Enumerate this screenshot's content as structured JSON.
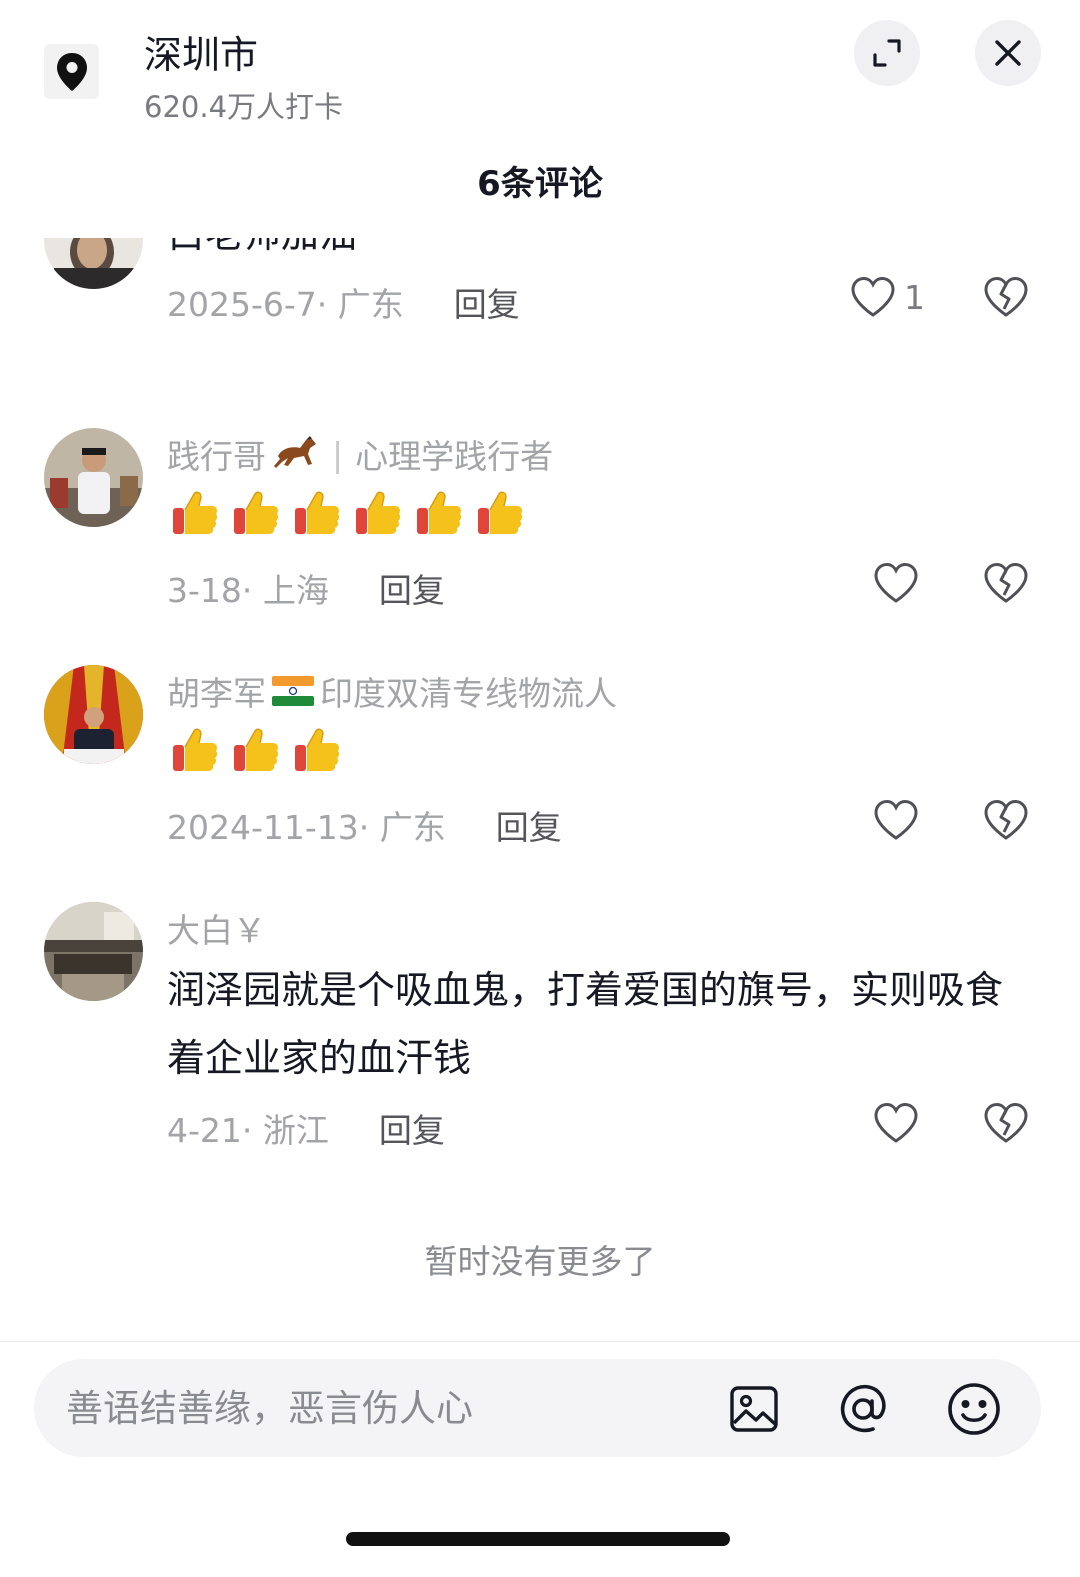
{
  "location": {
    "title": "深圳市",
    "checkins": "620.4万人打卡",
    "icon": "location-pin-icon"
  },
  "header": {
    "expand_icon": "expand-icon",
    "close_icon": "close-icon"
  },
  "comments_header": "6条评论",
  "comments": [
    {
      "author": "",
      "text": "白老师加油",
      "date_region": "2025-6-7· 广东",
      "reply_label": "回复",
      "like_count": "1"
    },
    {
      "author": "践行哥",
      "author_badge": "horse-emoji",
      "author_sep": "|",
      "author_title": "心理学践行者",
      "emoji": "thumbs-up",
      "emoji_count": 6,
      "date_region": "3-18· 上海",
      "reply_label": "回复"
    },
    {
      "author": "胡李军",
      "author_badge": "india-flag",
      "author_title": "印度双清专线物流人",
      "emoji": "thumbs-up",
      "emoji_count": 3,
      "date_region": "2024-11-13· 广东",
      "reply_label": "回复"
    },
    {
      "author": "大白￥",
      "text": "润泽园就是个吸血鬼，打着爱国的旗号，实则吸食着企业家的血汗钱",
      "date_region": "4-21· 浙江",
      "reply_label": "回复"
    }
  ],
  "no_more_text": "暂时没有更多了",
  "input": {
    "placeholder": "善语结善缘，恶言伤人心",
    "value": "",
    "icons": [
      "image-icon",
      "at-icon",
      "emoji-icon"
    ]
  },
  "colors": {
    "text_primary": "#161823",
    "text_secondary": "#a3a4a8",
    "input_bg": "#f4f4f6",
    "thumbs_up": "#f5c21b"
  }
}
